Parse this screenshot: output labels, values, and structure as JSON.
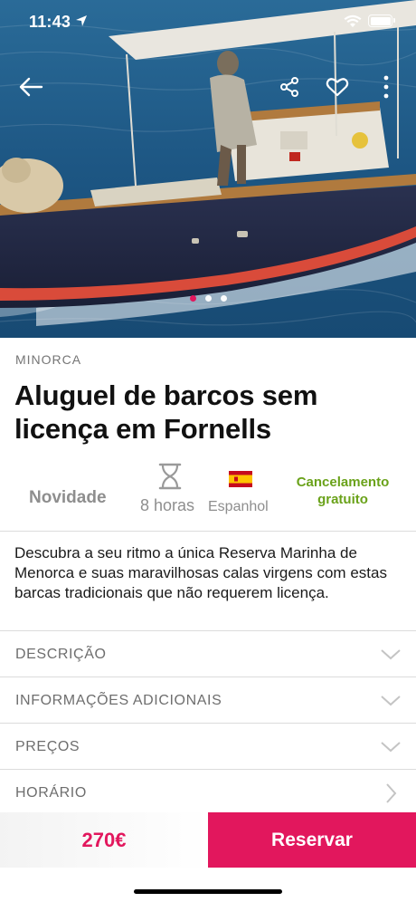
{
  "status": {
    "time": "11:43"
  },
  "hero": {
    "image_alt": "Boat with sailor on blue sea",
    "slides_total": 3,
    "active_slide": 1
  },
  "colors": {
    "accent": "#e2175d",
    "green": "#6aa21a",
    "muted": "#8e8e8e"
  },
  "region": "MINORCA",
  "title": "Aluguel de barcos sem licença em Fornells",
  "features": {
    "badge": "Novidade",
    "duration": "8 horas",
    "language": "Espanhol",
    "cancellation": "Cancelamento gratuito"
  },
  "description": "Descubra a seu ritmo a única Reserva Marinha de Menorca e suas maravilhosas calas virgens com estas barcas tradicionais que não requerem licença.",
  "sections": [
    {
      "label": "DESCRIÇÃO",
      "icon": "chevron-down-icon"
    },
    {
      "label": "INFORMAÇÕES ADICIONAIS",
      "icon": "chevron-down-icon"
    },
    {
      "label": "PREÇOS",
      "icon": "chevron-down-icon"
    },
    {
      "label": "HORÁRIO",
      "icon": "chevron-right-icon"
    }
  ],
  "booking": {
    "price": "270€",
    "button": "Reservar"
  }
}
